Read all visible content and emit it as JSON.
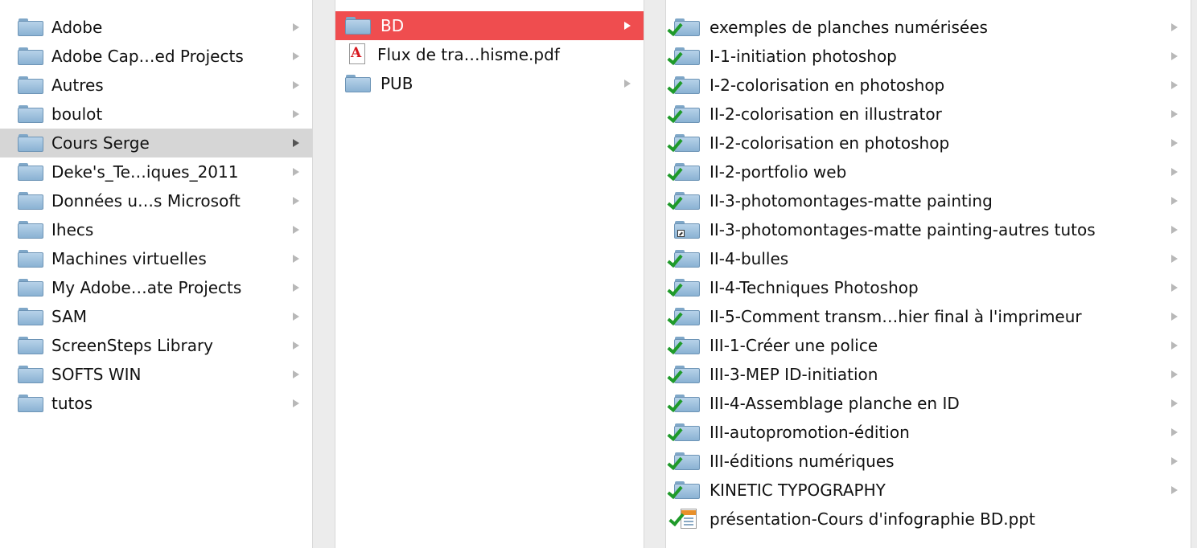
{
  "columns": {
    "column1": {
      "items": [
        {
          "label": "Adobe"
        },
        {
          "label": "Adobe Cap…ed Projects"
        },
        {
          "label": "Autres"
        },
        {
          "label": "boulot"
        },
        {
          "label": "Cours Serge"
        },
        {
          "label": "Deke's_Te…iques_2011"
        },
        {
          "label": "Données u…s Microsoft"
        },
        {
          "label": "Ihecs"
        },
        {
          "label": "Machines virtuelles"
        },
        {
          "label": "My Adobe…ate Projects"
        },
        {
          "label": "SAM"
        },
        {
          "label": "ScreenSteps Library"
        },
        {
          "label": "SOFTS WIN"
        },
        {
          "label": "tutos"
        }
      ],
      "selected": "Cours Serge"
    },
    "column2": {
      "items": [
        {
          "label": "BD"
        },
        {
          "label": "Flux de tra…hisme.pdf"
        },
        {
          "label": "PUB"
        }
      ],
      "selected": "BD"
    },
    "column3": {
      "items": [
        {
          "label": "exemples de planches numérisées"
        },
        {
          "label": "I-1-initiation photoshop"
        },
        {
          "label": "I-2-colorisation en photoshop"
        },
        {
          "label": "II-2-colorisation en illustrator"
        },
        {
          "label": "II-2-colorisation en photoshop"
        },
        {
          "label": "II-2-portfolio web"
        },
        {
          "label": "II-3-photomontages-matte painting"
        },
        {
          "label": "II-3-photomontages-matte painting-autres tutos"
        },
        {
          "label": "II-4-bulles"
        },
        {
          "label": "II-4-Techniques Photoshop"
        },
        {
          "label": "II-5-Comment transm…hier final à l'imprimeur"
        },
        {
          "label": "III-1-Créer une police"
        },
        {
          "label": "III-3-MEP ID-initiation"
        },
        {
          "label": "III-4-Assemblage planche en ID"
        },
        {
          "label": "III-autopromotion-édition"
        },
        {
          "label": "III-éditions numériques"
        },
        {
          "label": "KINETIC TYPOGRAPHY"
        },
        {
          "label": "présentation-Cours d'infographie BD.ppt"
        }
      ]
    }
  },
  "colors": {
    "selection_active": "#ef4d4f",
    "selection_inactive": "#d6d6d6",
    "folder": "#9fc2df",
    "sync_check": "#1f9a2a"
  }
}
